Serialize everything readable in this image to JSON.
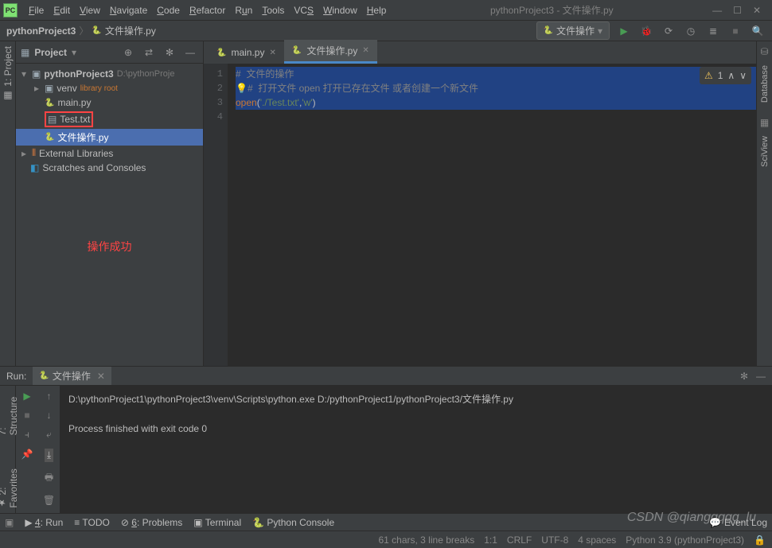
{
  "window": {
    "title": "pythonProject3 - 文件操作.py"
  },
  "menu": {
    "file": "File",
    "edit": "Edit",
    "view": "View",
    "navigate": "Navigate",
    "code": "Code",
    "refactor": "Refactor",
    "run": "Run",
    "tools": "Tools",
    "vcs": "VCS",
    "window": "Window",
    "help": "Help"
  },
  "breadcrumb": {
    "root": "pythonProject3",
    "file": "文件操作.py"
  },
  "runconfig": {
    "label": "文件操作"
  },
  "project_panel": {
    "title": "Project"
  },
  "tree": {
    "root": "pythonProject3",
    "root_path": "D:\\pythonProje",
    "venv": "venv",
    "venv_hint": "library root",
    "main": "main.py",
    "test": "Test.txt",
    "fileop": "文件操作.py",
    "ext": "External Libraries",
    "scratch": "Scratches and Consoles"
  },
  "success": "操作成功",
  "tabs": {
    "main": "main.py",
    "fileop": "文件操作.py"
  },
  "code": {
    "l1_comment": "#  文件的操作",
    "l2_comment": "#  打开文件 open 打开已存在文件 或者创建一个新文件",
    "l3_fn": "open",
    "l3_p1": "(",
    "l3_s1": "'./Test.txt'",
    "l3_c": ",",
    "l3_s2": "'w'",
    "l3_p2": ")"
  },
  "warn": {
    "count": "1"
  },
  "run": {
    "tab": "文件操作",
    "title": "Run:",
    "line1": "D:\\pythonProject1\\pythonProject3\\venv\\Scripts\\python.exe D:/pythonProject1/pythonProject3/文件操作.py",
    "line2": "Process finished with exit code 0"
  },
  "bottombar": {
    "run": "4: Run",
    "todo": "TODO",
    "problems": "6: Problems",
    "terminal": "Terminal",
    "pyconsole": "Python Console",
    "eventlog": "Event Log"
  },
  "sidebar_left": {
    "project": "1: Project",
    "structure": "7: Structure",
    "favorites": "2: Favorites"
  },
  "sidebar_right": {
    "database": "Database",
    "sciview": "SciView"
  },
  "status": {
    "chars": "61 chars, 3 line breaks",
    "pos": "1:1",
    "eol": "CRLF",
    "enc": "UTF-8",
    "indent": "4 spaces",
    "py": "Python 3.9 (pythonProject3)"
  },
  "watermark": "CSDN @qiangqqqq_lu"
}
